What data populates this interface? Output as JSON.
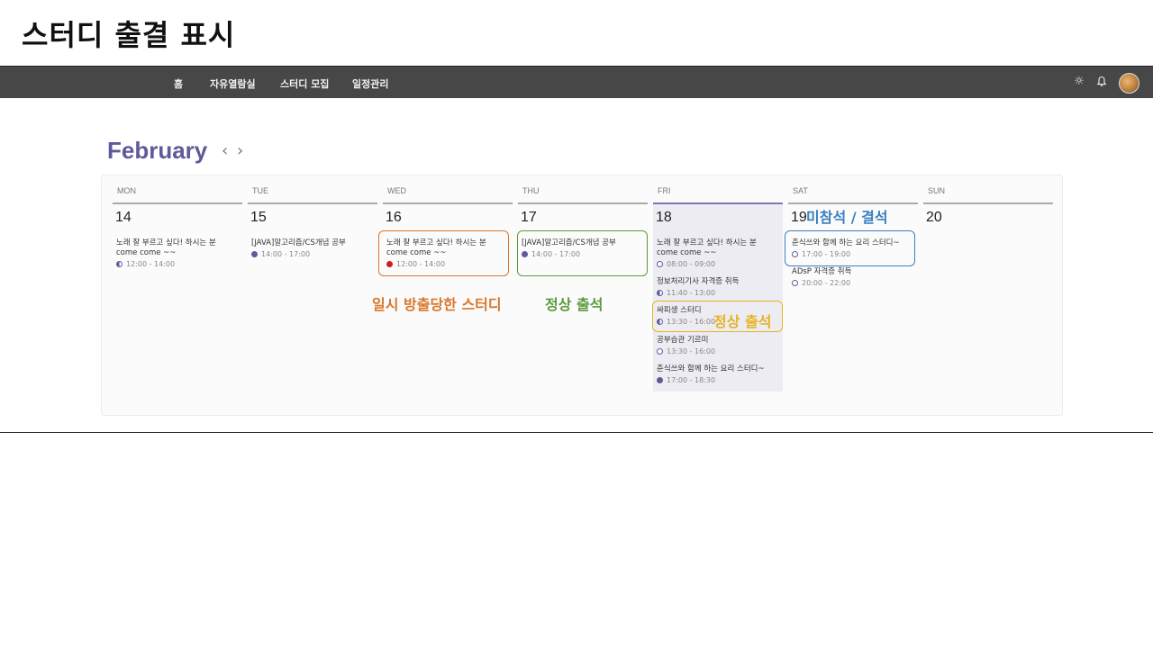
{
  "slide": {
    "title": "스터디 출결 표시"
  },
  "nav": {
    "items": [
      "홈",
      "자유열람실",
      "스터디 모집",
      "일정관리"
    ],
    "icons": [
      "sun-icon",
      "bell-icon",
      "avatar"
    ]
  },
  "calendar": {
    "month": "February",
    "prev_arrow": "‹",
    "next_arrow": "›",
    "days": [
      {
        "dow": "MON",
        "num": "14",
        "events": [
          {
            "title": "노래 잘 부르고 싶다! 하시는 분 come come ~~",
            "time": "12:00 - 14:00",
            "status": "half"
          }
        ]
      },
      {
        "dow": "TUE",
        "num": "15",
        "events": [
          {
            "title": "[JAVA]알고리즘/CS개념 공부",
            "time": "14:00 - 17:00",
            "status": "full"
          }
        ]
      },
      {
        "dow": "WED",
        "num": "16",
        "events": [
          {
            "title": "노래 잘 부르고 싶다! 하시는 분 come come ~~",
            "time": "12:00 - 14:00",
            "status": "red"
          }
        ]
      },
      {
        "dow": "THU",
        "num": "17",
        "events": [
          {
            "title": "[JAVA]알고리즘/CS개념 공부",
            "time": "14:00 - 17:00",
            "status": "full"
          }
        ]
      },
      {
        "dow": "FRI",
        "num": "18",
        "events": [
          {
            "title": "노래 잘 부르고 싶다! 하시는 분 come come ~~",
            "time": "08:00 - 09:00",
            "status": "empty"
          },
          {
            "title": "정보처리기사 자격증 취득",
            "time": "11:40 - 13:00",
            "status": "half"
          },
          {
            "title": "싸피생 스터디",
            "time": "13:30 - 16:00",
            "status": "half"
          },
          {
            "title": "공부습관 기르미",
            "time": "13:30 - 16:00",
            "status": "empty"
          },
          {
            "title": "춘식쓰와 함께 하는 요리 스터디~",
            "time": "17:00 - 18:30",
            "status": "full"
          }
        ]
      },
      {
        "dow": "SAT",
        "num": "19",
        "events": [
          {
            "title": "춘식쓰와 함께 하는 요리 스터디~",
            "time": "17:00 - 19:00",
            "status": "empty"
          },
          {
            "title": "ADsP 자격증 취득",
            "time": "20:00 - 22:00",
            "status": "empty"
          }
        ]
      },
      {
        "dow": "SUN",
        "num": "20",
        "events": []
      }
    ]
  },
  "annotations": {
    "wed": {
      "text": "일시 방출당한 스터디",
      "color": "#d9772b"
    },
    "thu": {
      "text": "정상 출석",
      "color": "#5a9a3a"
    },
    "fri": {
      "text": "정상 출석",
      "color": "#e6b422"
    },
    "sat": {
      "text": "미참석 / 결석",
      "color": "#3a7fbf"
    }
  }
}
